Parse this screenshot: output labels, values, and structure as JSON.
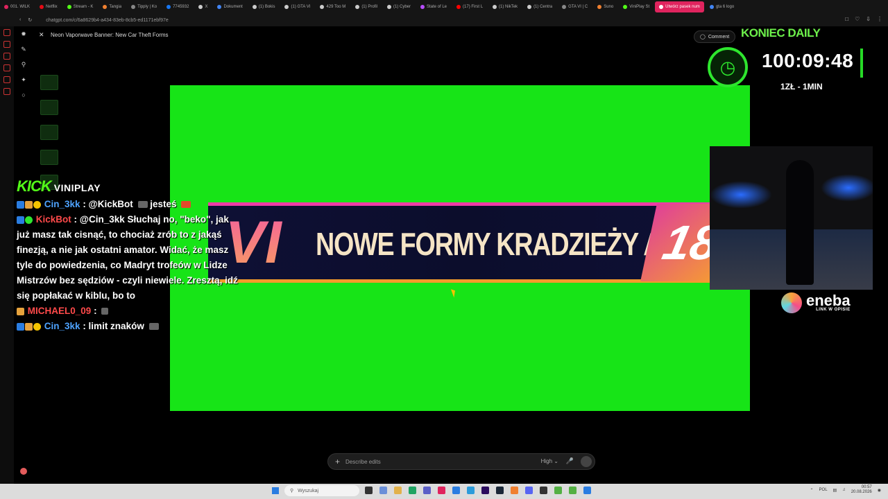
{
  "browser": {
    "tabs": [
      {
        "label": "001. WILK",
        "color": "#e0245e"
      },
      {
        "label": "Netflix",
        "color": "#e50914"
      },
      {
        "label": "Stream - K",
        "color": "#53fc18"
      },
      {
        "label": "Tangia",
        "color": "#f08030"
      },
      {
        "label": "Tipply | Ko",
        "color": "#888888"
      },
      {
        "label": "7745932",
        "color": "#1877f2"
      },
      {
        "label": "X",
        "color": "#cccccc"
      },
      {
        "label": "Dokument",
        "color": "#4285f4"
      },
      {
        "label": "(1) Bokis",
        "color": "#cccccc"
      },
      {
        "label": "(1) GTA VI",
        "color": "#cccccc"
      },
      {
        "label": "429 Too M",
        "color": "#cccccc"
      },
      {
        "label": "(1) Profil",
        "color": "#cccccc"
      },
      {
        "label": "(1) Cyber",
        "color": "#cccccc"
      },
      {
        "label": "State of Le",
        "color": "#b84dff"
      },
      {
        "label": "(17) First L",
        "color": "#ff0000"
      },
      {
        "label": "(1) NikTek",
        "color": "#cccccc"
      },
      {
        "label": "(1) Centra",
        "color": "#cccccc"
      },
      {
        "label": "GTA VI | C",
        "color": "#888888"
      },
      {
        "label": "Suno",
        "color": "#f08030"
      },
      {
        "label": "ViniPlay St",
        "color": "#53fc18"
      },
      {
        "label": "Utwórz pasek num",
        "color": "#ffffff",
        "active": true
      },
      {
        "label": "gta 6 logo",
        "color": "#4285f4"
      }
    ],
    "url": "chatgpt.com/c/6a8629b4-a434-83eb-8cb5-ed1171ebf97e"
  },
  "chatgpt": {
    "title": "Neon Vaporwave Banner: New Car Theft Forms",
    "comment_label": "Comment",
    "composer_placeholder": "Describe edits",
    "quality": "High"
  },
  "overlay": {
    "top_text": "KONIEC DAILY",
    "timer": "100:09:48",
    "rate": "1ZŁ - 1MIN",
    "sponsor": "eneba",
    "sponsor_sub": "LINK W OPISIE"
  },
  "banner": {
    "left_mark": "VI",
    "title": "NOWE FORMY KRADZIEŻY AUTA",
    "age": "18"
  },
  "chat": {
    "platform": "KICK",
    "channel": "VINIPLAY",
    "messages": [
      {
        "user": "Cin_3kk",
        "text": ": @KickBot",
        "tail": "jesteś"
      },
      {
        "user": "KickBot",
        "text": ": @Cin_3kk Słuchaj no, \"beko\", jak już masz tak cisnąć, to chociaż zrób to z jakąś finezją, a nie jak ostatni amator. Widać, że masz tyle do powiedzenia, co Madryt trofeów w Lidze Mistrzów bez sędziów - czyli niewiele. Zresztą, idź się popłakać w kiblu, bo to"
      },
      {
        "user": "MICHAEL0_09",
        "text": ":"
      },
      {
        "user": "Cin_3kk",
        "text": ": limit znaków"
      }
    ]
  },
  "taskbar": {
    "search_placeholder": "Wyszukaj",
    "lang": "POL",
    "time": "00:57",
    "date": "20.08.2026"
  }
}
